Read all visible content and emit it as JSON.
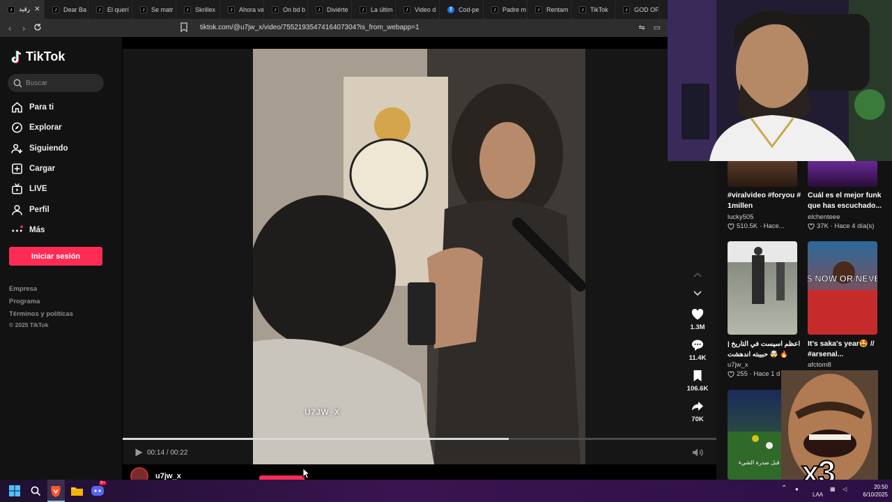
{
  "browser": {
    "tabs": [
      {
        "label": "رقيد",
        "icon": "tiktok-icon",
        "active": true
      },
      {
        "label": "Dear Ba",
        "icon": "tiktok-icon"
      },
      {
        "label": "El querí",
        "icon": "tiktok-icon"
      },
      {
        "label": "Se matr",
        "icon": "tiktok-icon"
      },
      {
        "label": "Skrillex",
        "icon": "tiktok-icon"
      },
      {
        "label": "Ahora va",
        "icon": "tiktok-icon"
      },
      {
        "label": "On bd b",
        "icon": "tiktok-icon"
      },
      {
        "label": "Diviérte",
        "icon": "tiktok-icon"
      },
      {
        "label": "La últim",
        "icon": "tiktok-icon"
      },
      {
        "label": "Video d",
        "icon": "tiktok-icon"
      },
      {
        "label": "Cod-pe",
        "icon": "facebook-icon"
      },
      {
        "label": "Padre m",
        "icon": "tiktok-icon"
      },
      {
        "label": "Rentam",
        "icon": "tiktok-icon"
      },
      {
        "label": "TikTok",
        "icon": "tiktok-icon"
      },
      {
        "label": "GOD OF",
        "icon": "tiktok-icon"
      }
    ],
    "url": "tiktok.com/@u7jw_x/video/7552193547416407304?is_from_webapp=1"
  },
  "sidebar": {
    "logo": "TikTok",
    "search_placeholder": "Buscar",
    "nav": [
      {
        "label": "Para ti",
        "icon": "home-icon"
      },
      {
        "label": "Explorar",
        "icon": "compass-icon"
      },
      {
        "label": "Siguiendo",
        "icon": "following-icon"
      },
      {
        "label": "Cargar",
        "icon": "upload-icon"
      },
      {
        "label": "LIVE",
        "icon": "live-icon"
      },
      {
        "label": "Perfil",
        "icon": "profile-icon"
      },
      {
        "label": "Más",
        "icon": "more-icon"
      }
    ],
    "login": "Iniciar sesión",
    "footer": [
      "Empresa",
      "Programa",
      "Términos y políticas"
    ],
    "copyright": "© 2025 TikTok"
  },
  "video": {
    "watermark": "U7JW_X",
    "time": "00:14 / 00:22",
    "progress": 0.65,
    "author_name": "u7jw_x",
    "actions": [
      {
        "icon": "heart-icon",
        "count": "1.3M"
      },
      {
        "icon": "comment-icon",
        "count": "11.4K"
      },
      {
        "icon": "bookmark-icon",
        "count": "106.6K"
      },
      {
        "icon": "share-icon",
        "count": "70K"
      }
    ]
  },
  "recs": [
    {
      "title": "#viralvideo #foryou # 1millen",
      "author": "lucky505",
      "likes": "510.5K",
      "when": "Hace..."
    },
    {
      "title": "Cuál es el mejor funk que has escuchado...",
      "author": "elchenteee",
      "likes": "37K",
      "when": "Hace 4 día(s)"
    },
    {
      "title": "اعظم اسيست في التاريخ | حبيبته اندهشت 🤯 🔥",
      "author": "u7jw_x",
      "likes": "255",
      "when": "Hace 1 d"
    },
    {
      "title": "It's saka's year🤩 // #arsenal...",
      "author": "afctom8",
      "likes": "",
      "when": ""
    }
  ],
  "thumb_text": "ITS NOW OR NEVER",
  "thumb5_text": "قبل صدرة الشيء ♥",
  "meme_badge": "x3",
  "taskbar": {
    "lang": "LAA",
    "time": "20:50",
    "date": "6/10/2025",
    "badge": "9+"
  }
}
